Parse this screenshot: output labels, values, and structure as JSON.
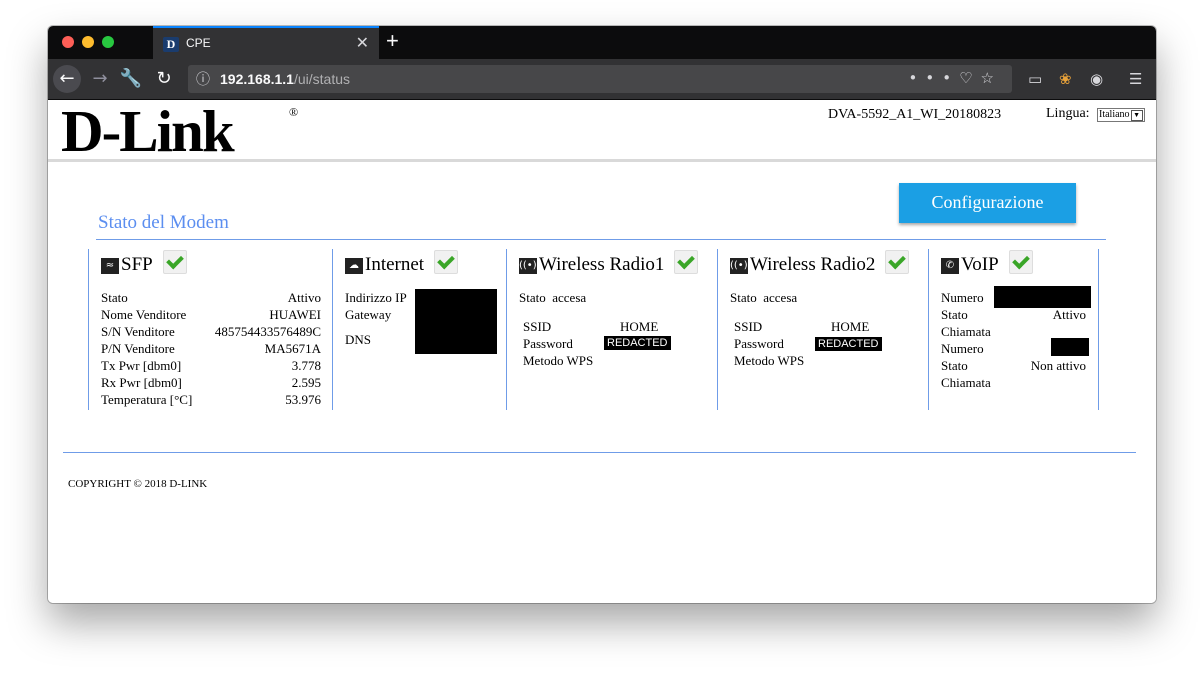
{
  "browser": {
    "tab_title": "CPE",
    "tab_favicon": "D",
    "url_host": "192.168.1.1",
    "url_path": "/ui/status"
  },
  "page": {
    "model": "DVA-5592_A1_WI_20180823",
    "language_label": "Lingua:",
    "language_value": "Italiano",
    "config_button": "Configurazione",
    "section_title": "Stato del Modem",
    "copyright": "COPYRIGHT © 2018 D-LINK",
    "logo": "D-Link",
    "logo_reg": "®"
  },
  "sfp": {
    "title": "SFP",
    "rows": [
      {
        "label": "Stato",
        "value": "Attivo"
      },
      {
        "label": "Nome Venditore",
        "value": "HUAWEI"
      },
      {
        "label": "S/N Venditore",
        "value": "485754433576489C"
      },
      {
        "label": "P/N Venditore",
        "value": "MA5671A"
      },
      {
        "label": "Tx Pwr [dbm0]",
        "value": "3.778"
      },
      {
        "label": "Rx Pwr [dbm0]",
        "value": "2.595"
      },
      {
        "label": "Temperatura [°C]",
        "value": "53.976"
      }
    ]
  },
  "internet": {
    "title": "Internet",
    "rows": [
      {
        "label": "Indirizzo IP"
      },
      {
        "label": "Gateway"
      },
      {
        "label": "DNS"
      }
    ]
  },
  "radio1": {
    "title": "Wireless Radio1",
    "state_label": "Stato",
    "state_value": "accesa",
    "ssid_label": "SSID",
    "ssid_value": "HOME",
    "password_label": "Password",
    "password_value": "REDACTED",
    "wps_label": "Metodo WPS"
  },
  "radio2": {
    "title": "Wireless Radio2",
    "state_label": "Stato",
    "state_value": "accesa",
    "ssid_label": "SSID",
    "ssid_value": "HOME",
    "password_label": "Password",
    "password_value": "REDACTED",
    "wps_label": "Metodo WPS"
  },
  "voip": {
    "title": "VoIP",
    "numero1_label": "Numero",
    "state1_label_a": "Stato",
    "state1_label_b": "Chiamata",
    "state1_value": "Attivo",
    "numero2_label": "Numero",
    "state2_label_a": "Stato",
    "state2_label_b": "Chiamata",
    "state2_value": "Non attivo"
  }
}
